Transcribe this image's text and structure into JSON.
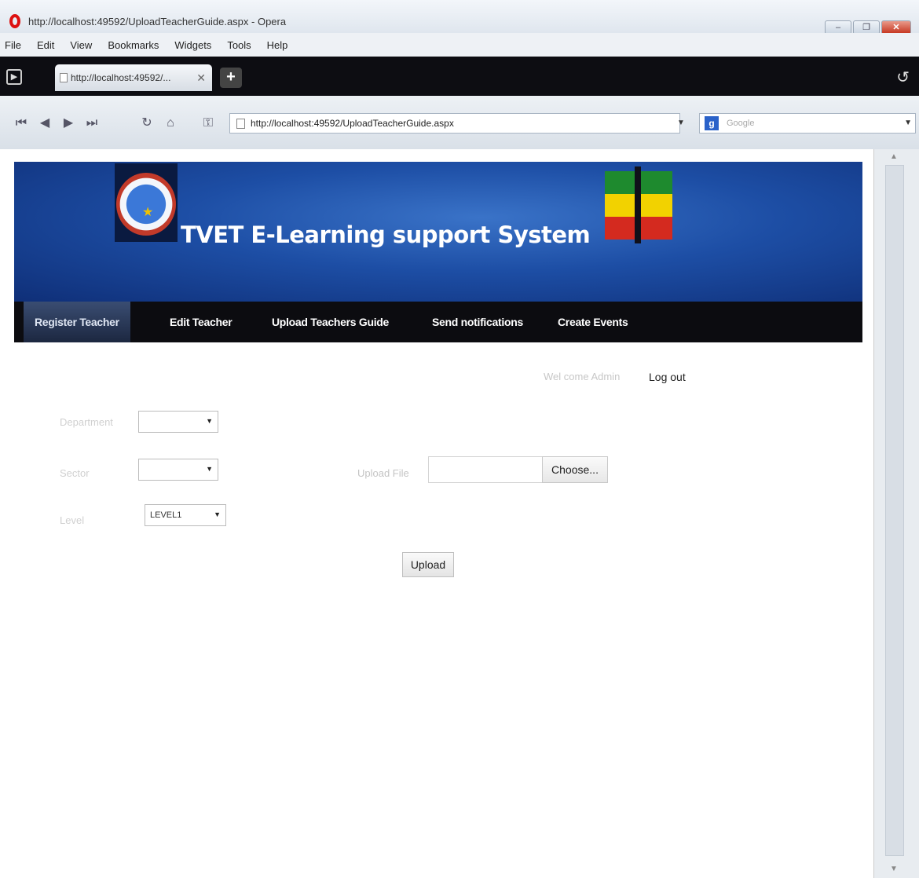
{
  "window": {
    "title": "http://localhost:49592/UploadTeacherGuide.aspx - Opera",
    "minimize": "–",
    "restore": "❐",
    "close": "✕"
  },
  "menu": [
    "File",
    "Edit",
    "View",
    "Bookmarks",
    "Widgets",
    "Tools",
    "Help"
  ],
  "tab": {
    "title": "http://localhost:49592/...",
    "close": "✕",
    "new_tab": "+"
  },
  "toolbar": {
    "url": "http://localhost:49592/UploadTeacherGuide.aspx",
    "search_placeholder": "Google",
    "search_engine_letter": "g"
  },
  "site": {
    "title": "TVET E-Learning support System"
  },
  "nav": {
    "items": [
      "Register Teacher",
      "Edit Teacher",
      "Upload Teachers Guide",
      "Send notifications",
      "Create Events"
    ],
    "active_index": 0
  },
  "user": {
    "welcome": "Wel come Admin",
    "logout": "Log out"
  },
  "form": {
    "department_label": "Department",
    "department_value": "",
    "sector_label": "Sector",
    "sector_value": "",
    "level_label": "Level",
    "level_value": "LEVEL1",
    "upload_file_label": "Upload File",
    "choose_label": "Choose...",
    "upload_button": "Upload"
  },
  "colors": {
    "banner": "#1d4ea5",
    "nav_strip": "#0c0c10",
    "active_tab": "#2c3a5a"
  }
}
